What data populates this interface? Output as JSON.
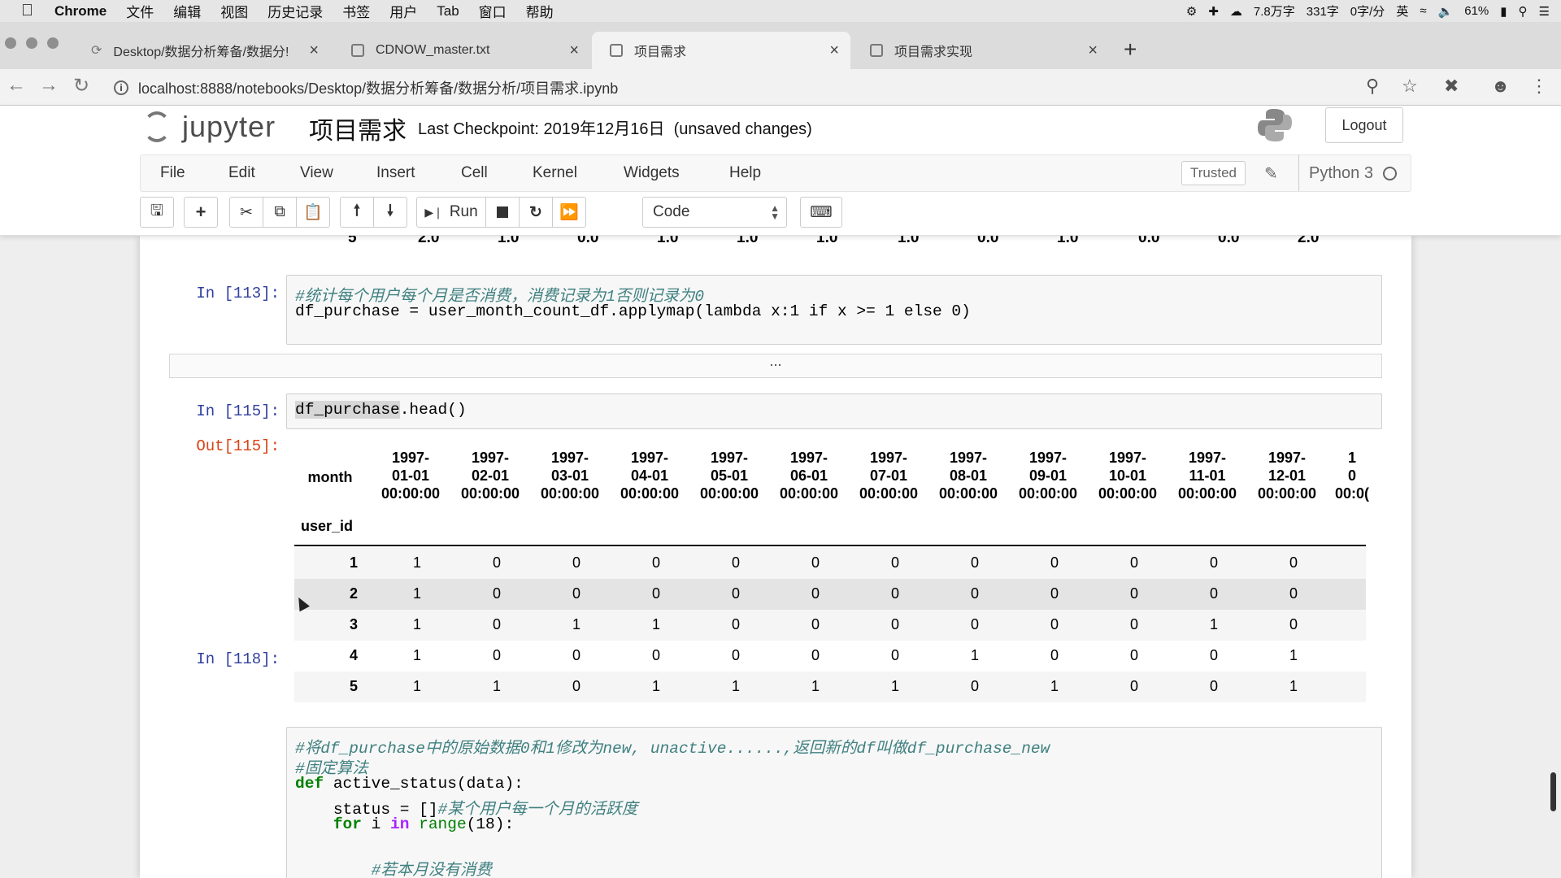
{
  "macos_menubar": {
    "items": [
      "Chrome",
      "文件",
      "编辑",
      "视图",
      "历史记录",
      "书签",
      "用户",
      "Tab",
      "窗口",
      "帮助"
    ],
    "status": {
      "wordcount": "7.8万字",
      "chars": "331字",
      "speed": "0字/分",
      "battery": "61%",
      "ime": "英"
    }
  },
  "browser": {
    "tabs": [
      {
        "title": "Desktop/数据分析筹备/数据分!"
      },
      {
        "title": "CDNOW_master.txt"
      },
      {
        "title": "项目需求"
      },
      {
        "title": "项目需求实现"
      }
    ],
    "active_tab": 2,
    "url": "localhost:8888/notebooks/Desktop/数据分析筹备/数据分析/项目需求.ipynb"
  },
  "jupyter": {
    "logo_text": "jupyter",
    "notebook_title": "项目需求",
    "checkpoint": "Last Checkpoint: 2019年12月16日",
    "unsaved": "(unsaved changes)",
    "logout_label": "Logout",
    "menus": [
      "File",
      "Edit",
      "View",
      "Insert",
      "Cell",
      "Kernel",
      "Widgets",
      "Help"
    ],
    "trusted_label": "Trusted",
    "kernel_name": "Python 3",
    "run_label": "Run",
    "cell_type": "Code"
  },
  "prev_output_row": [
    "5",
    "2.0",
    "1.0",
    "0.0",
    "1.0",
    "1.0",
    "1.0",
    "1.0",
    "0.0",
    "1.0",
    "0.0",
    "0.0",
    "2.0"
  ],
  "cells": {
    "c113": {
      "prompt": "In [113]:",
      "comment": "#统计每个用户每个月是否消费，消费记录为1否则记录为0",
      "code": "df_purchase = user_month_count_df.applymap(lambda x:1 if x >= 1 else 0)"
    },
    "collapsed_marker": "...",
    "c115": {
      "prompt": "In [115]:",
      "code_highlight": "df_purchase",
      "code_rest": ".head()",
      "out_prompt": "Out[115]:"
    },
    "c118": {
      "prompt": "In [118]:",
      "lines": [
        "#将df_purchase中的原始数据0和1修改为new, unactive......,返回新的df叫做df_purchase_new",
        "#固定算法",
        "def active_status(data):",
        "    status = []#某个用户每一个月的活跃度",
        "    for i in range(18):",
        "",
        "        #若本月没有消费"
      ]
    }
  },
  "dataframe": {
    "columns_name": "month",
    "index_name": "user_id",
    "columns": [
      [
        "1997-",
        "01-01",
        "00:00:00"
      ],
      [
        "1997-",
        "02-01",
        "00:00:00"
      ],
      [
        "1997-",
        "03-01",
        "00:00:00"
      ],
      [
        "1997-",
        "04-01",
        "00:00:00"
      ],
      [
        "1997-",
        "05-01",
        "00:00:00"
      ],
      [
        "1997-",
        "06-01",
        "00:00:00"
      ],
      [
        "1997-",
        "07-01",
        "00:00:00"
      ],
      [
        "1997-",
        "08-01",
        "00:00:00"
      ],
      [
        "1997-",
        "09-01",
        "00:00:00"
      ],
      [
        "1997-",
        "10-01",
        "00:00:00"
      ],
      [
        "1997-",
        "11-01",
        "00:00:00"
      ],
      [
        "1997-",
        "12-01",
        "00:00:00"
      ],
      [
        "1",
        "0",
        "00:0("
      ]
    ],
    "rows": [
      {
        "id": "1",
        "values": [
          "1",
          "0",
          "0",
          "0",
          "0",
          "0",
          "0",
          "0",
          "0",
          "0",
          "0",
          "0"
        ]
      },
      {
        "id": "2",
        "values": [
          "1",
          "0",
          "0",
          "0",
          "0",
          "0",
          "0",
          "0",
          "0",
          "0",
          "0",
          "0"
        ]
      },
      {
        "id": "3",
        "values": [
          "1",
          "0",
          "1",
          "1",
          "0",
          "0",
          "0",
          "0",
          "0",
          "0",
          "1",
          "0"
        ]
      },
      {
        "id": "4",
        "values": [
          "1",
          "0",
          "0",
          "0",
          "0",
          "0",
          "0",
          "1",
          "0",
          "0",
          "0",
          "1"
        ]
      },
      {
        "id": "5",
        "values": [
          "1",
          "1",
          "0",
          "1",
          "1",
          "1",
          "1",
          "0",
          "1",
          "0",
          "0",
          "1"
        ]
      }
    ]
  }
}
